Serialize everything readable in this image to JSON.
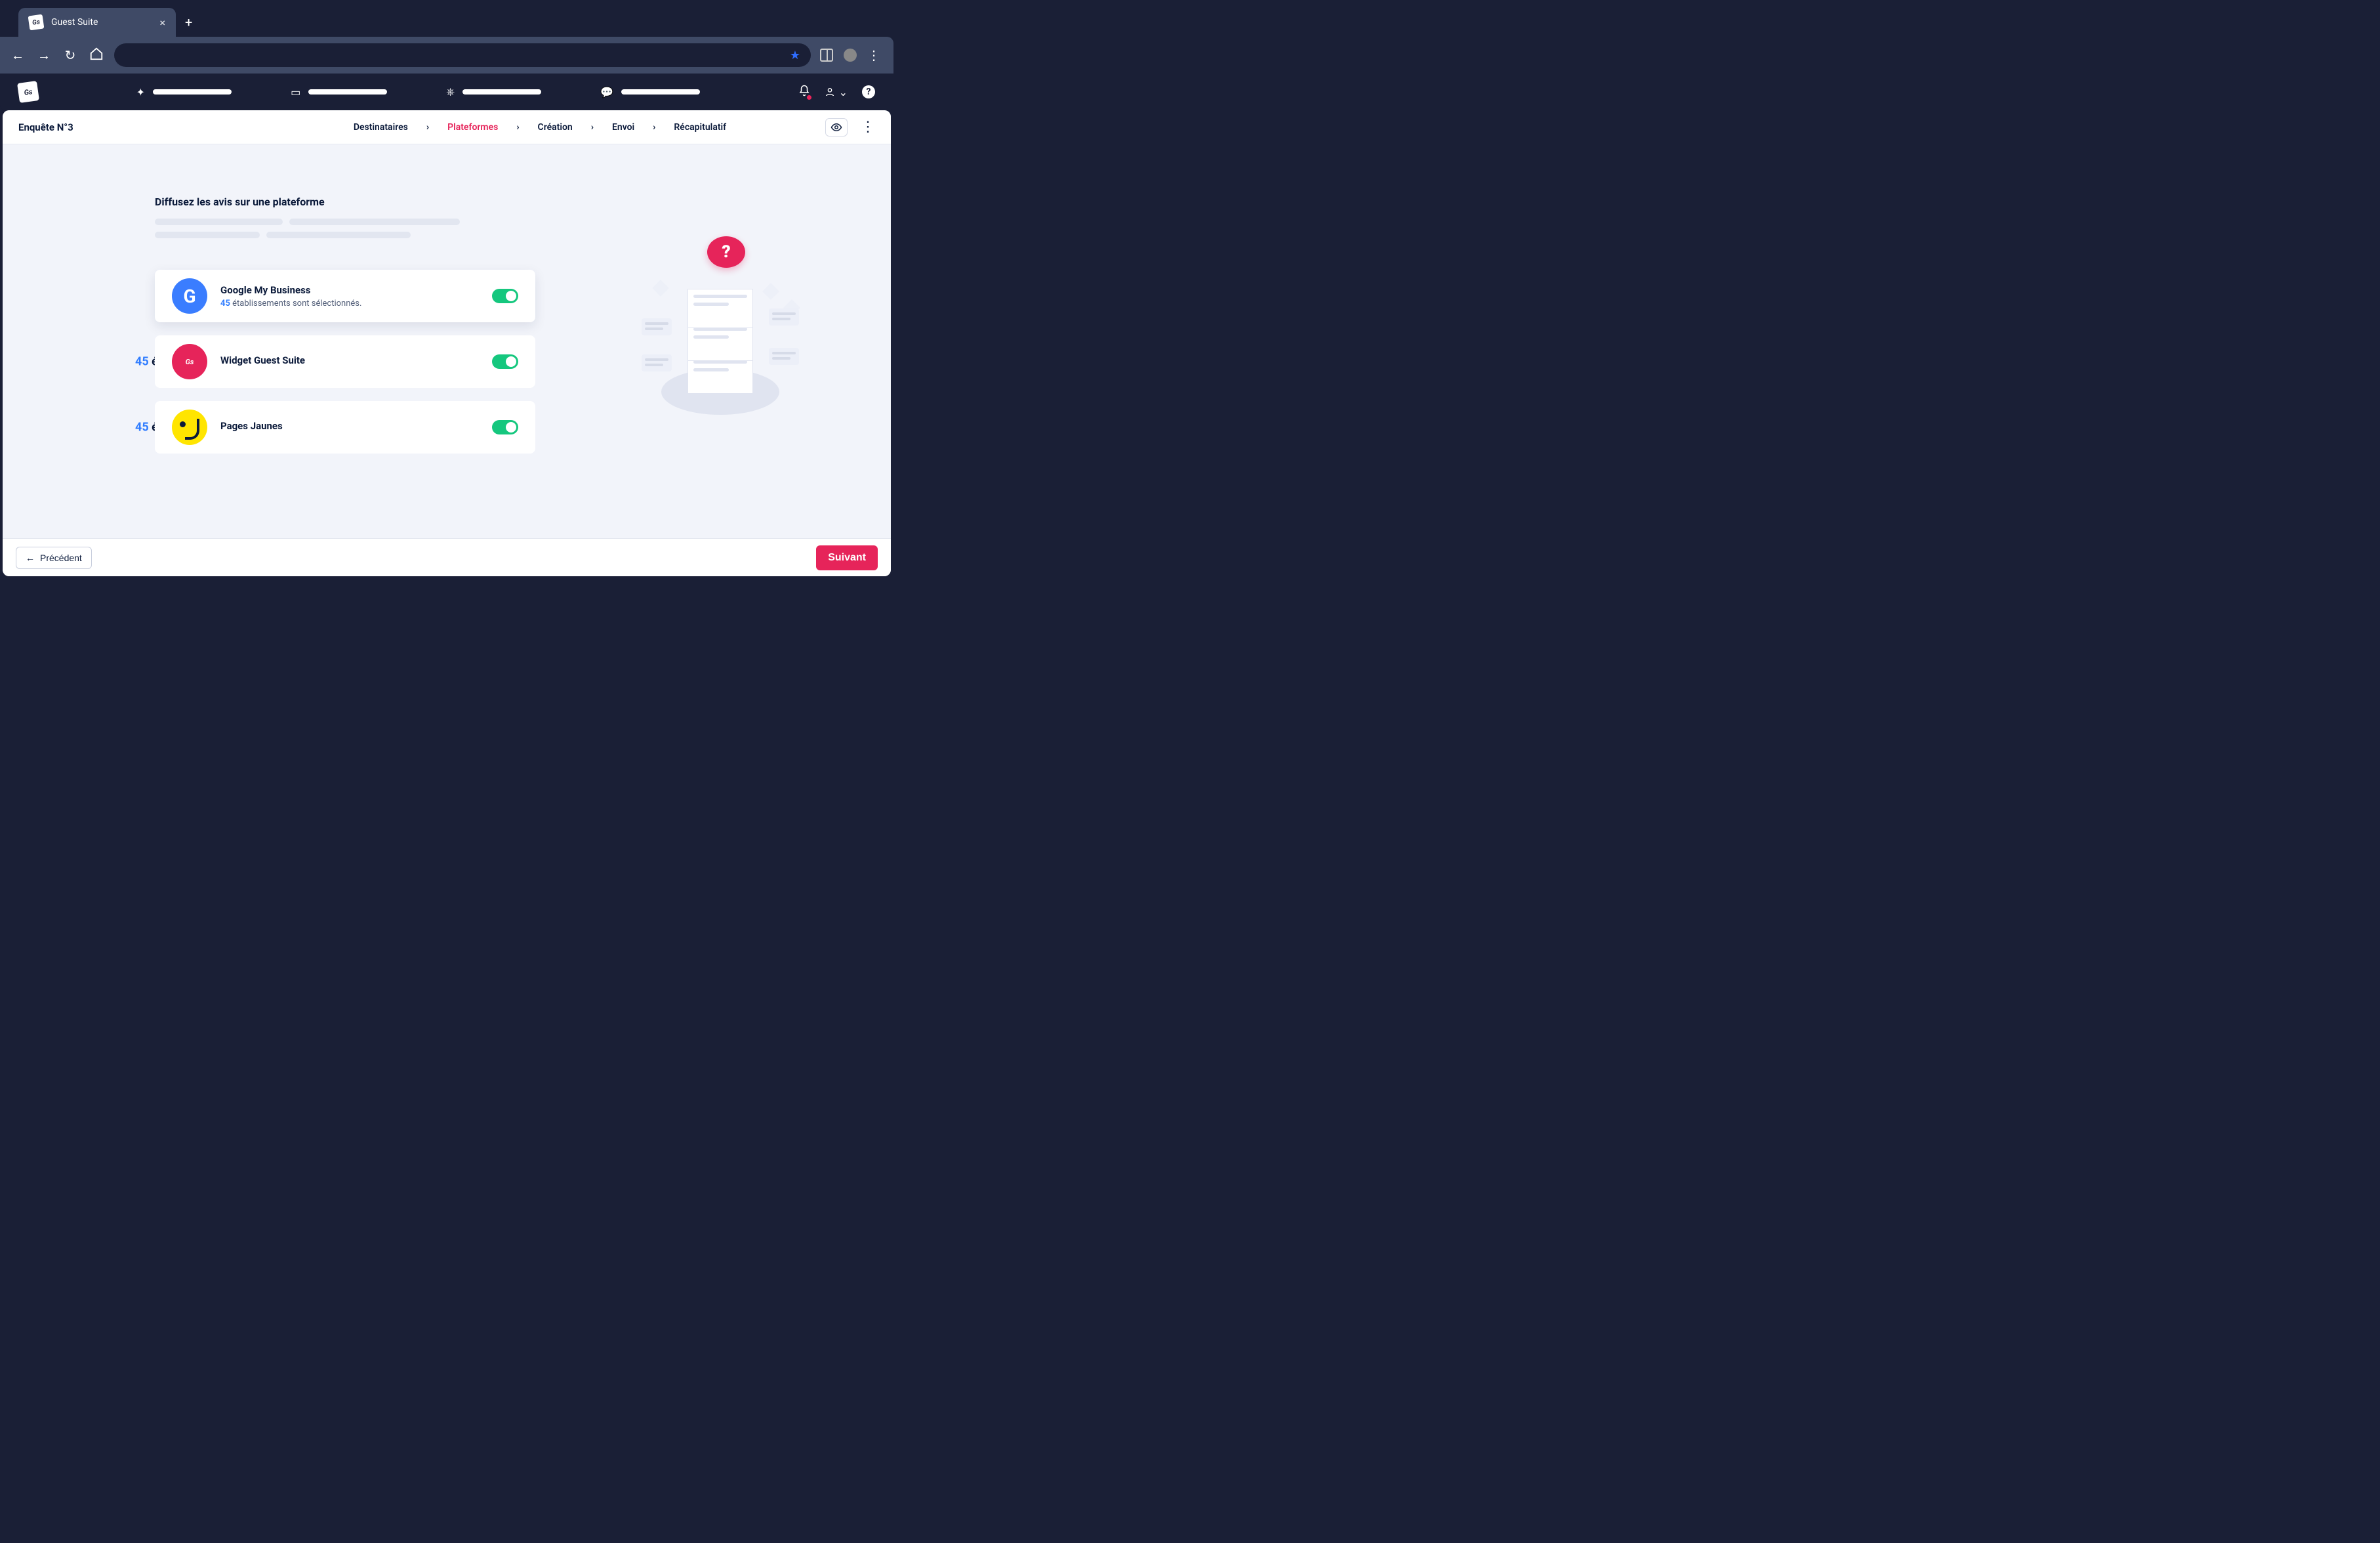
{
  "browser": {
    "tab_title": "Guest Suite"
  },
  "page": {
    "title": "Enquête N°3"
  },
  "stepper": {
    "steps": [
      {
        "label": "Destinataires"
      },
      {
        "label": "Plateformes"
      },
      {
        "label": "Création"
      },
      {
        "label": "Envoi"
      },
      {
        "label": "Récapitulatif"
      }
    ],
    "active_index": 1
  },
  "section": {
    "heading": "Diffusez les avis sur une plateforme"
  },
  "platforms": [
    {
      "name": "Google My Business",
      "count": 45,
      "sub_suffix": "établissements sont sélectionnés.",
      "enabled": true
    },
    {
      "name": "Widget Guest Suite",
      "impact_count": 45,
      "impact_suffix": "établissements seront impactés.",
      "enabled": true
    },
    {
      "name": "Pages Jaunes",
      "impact_count": 45,
      "impact_suffix": "établissements seront impactés.",
      "enabled": true
    }
  ],
  "footer": {
    "prev": "Précédent",
    "next": "Suivant"
  },
  "illustration": {
    "bubble": "?"
  }
}
